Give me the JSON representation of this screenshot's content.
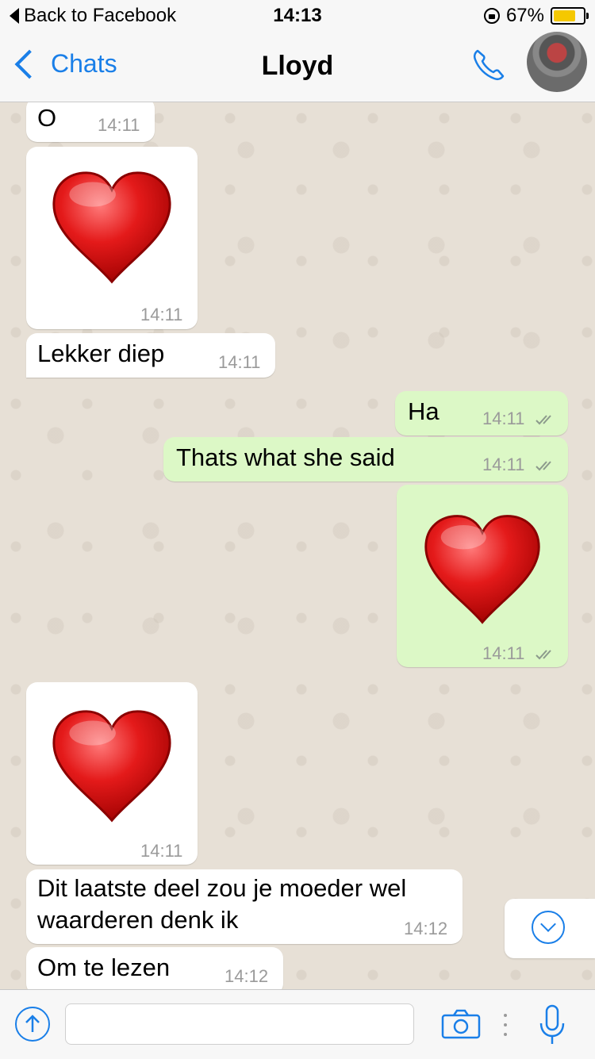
{
  "status_bar": {
    "back_label": "Back to Facebook",
    "time": "14:13",
    "battery": "67%",
    "battery_level": 0.67
  },
  "nav": {
    "back_label": "Chats",
    "title": "Lloyd"
  },
  "messages": [
    {
      "direction": "in",
      "kind": "text",
      "text": "O",
      "time": "14:11"
    },
    {
      "direction": "in",
      "kind": "emoji",
      "emoji": "red-heart",
      "time": "14:11"
    },
    {
      "direction": "in",
      "kind": "text",
      "text": "Lekker diep",
      "time": "14:11"
    },
    {
      "direction": "out",
      "kind": "text",
      "text": "Ha",
      "time": "14:11",
      "status": "delivered"
    },
    {
      "direction": "out",
      "kind": "text",
      "text": "Thats what she said",
      "time": "14:11",
      "status": "delivered"
    },
    {
      "direction": "out",
      "kind": "emoji",
      "emoji": "red-heart",
      "time": "14:11",
      "status": "delivered"
    },
    {
      "direction": "in",
      "kind": "emoji",
      "emoji": "red-heart",
      "time": "14:11"
    },
    {
      "direction": "in",
      "kind": "text",
      "text_line1": "Dit laatste deel zou je moeder wel",
      "text_line2": "waarderen denk ik",
      "time": "14:12"
    },
    {
      "direction": "in",
      "kind": "text",
      "text": "Om te lezen",
      "time": "14:12"
    }
  ],
  "input": {
    "placeholder": ""
  },
  "icons": {
    "call": "phone-icon",
    "upload": "upload-arrow-icon",
    "camera": "camera-icon",
    "mic": "microphone-icon",
    "scroll": "chevron-down-circle-icon"
  },
  "colors": {
    "accent": "#1a7fe8",
    "incoming_bubble": "#ffffff",
    "outgoing_bubble": "#dcf8c6",
    "chat_background": "#e7e0d6"
  }
}
